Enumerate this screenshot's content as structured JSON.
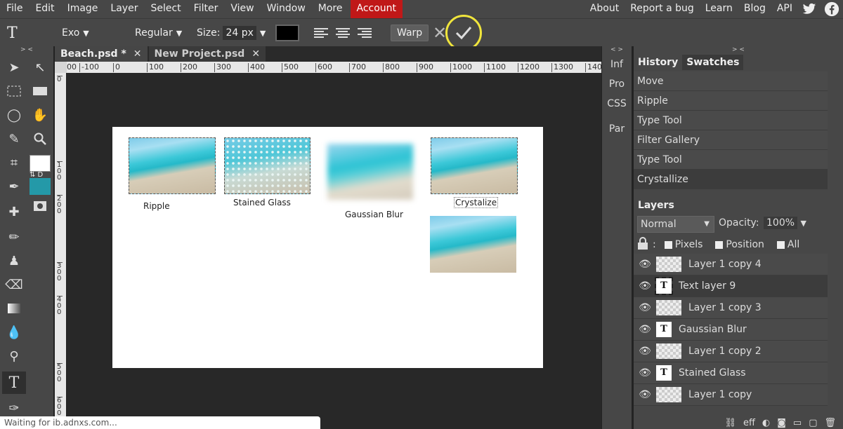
{
  "menu": {
    "items": [
      "File",
      "Edit",
      "Image",
      "Layer",
      "Select",
      "Filter",
      "View",
      "Window",
      "More"
    ],
    "account": "Account",
    "right": [
      "About",
      "Report a bug",
      "Learn",
      "Blog",
      "API"
    ]
  },
  "options": {
    "font_family": "Exo",
    "font_style": "Regular",
    "size_label": "Size:",
    "size_value": "24 px",
    "warp": "Warp"
  },
  "tabs": [
    {
      "label": "Beach.psd *"
    },
    {
      "label": "New Project.psd"
    }
  ],
  "ruler": {
    "h": [
      "200",
      "-100",
      "0",
      "100",
      "200",
      "300",
      "400",
      "500",
      "600",
      "700",
      "800",
      "900",
      "1000",
      "1100",
      "1200",
      "1300",
      "140"
    ],
    "v": [
      "0",
      "100",
      "200",
      "300",
      "400",
      "500",
      "600"
    ]
  },
  "canvas": {
    "labels": {
      "ripple": "Ripple",
      "stained": "Stained Glass",
      "gauss": "Gaussian Blur",
      "crystallize": "Crystalize"
    }
  },
  "midpanel": [
    "Inf",
    "Pro",
    "CSS",
    "Par"
  ],
  "panels": {
    "history_tab": "History",
    "swatches_tab": "Swatches",
    "history": [
      "Move",
      "Ripple",
      "Type Tool",
      "Filter Gallery",
      "Type Tool",
      "Crystallize"
    ],
    "layers_tab": "Layers",
    "blend_mode": "Normal",
    "opacity_label": "Opacity:",
    "opacity_value": "100%",
    "lock_pixels": "Pixels",
    "lock_position": "Position",
    "lock_all": "All",
    "layers": [
      {
        "name": "Layer 1 copy 4",
        "type": "image"
      },
      {
        "name": "Text layer 9",
        "type": "text"
      },
      {
        "name": "Layer 1 copy 3",
        "type": "image"
      },
      {
        "name": "Gaussian Blur",
        "type": "text"
      },
      {
        "name": "Layer 1 copy 2",
        "type": "image"
      },
      {
        "name": "Stained Glass",
        "type": "text"
      },
      {
        "name": "Layer 1 copy",
        "type": "image"
      }
    ],
    "bottom_eff": "eff"
  },
  "status": "Waiting for ib.adnxs.com...",
  "colors": {
    "fg": "#ffffff",
    "bg": "#2499a8",
    "account": "#c01818",
    "highlight": "#f0e53c"
  }
}
